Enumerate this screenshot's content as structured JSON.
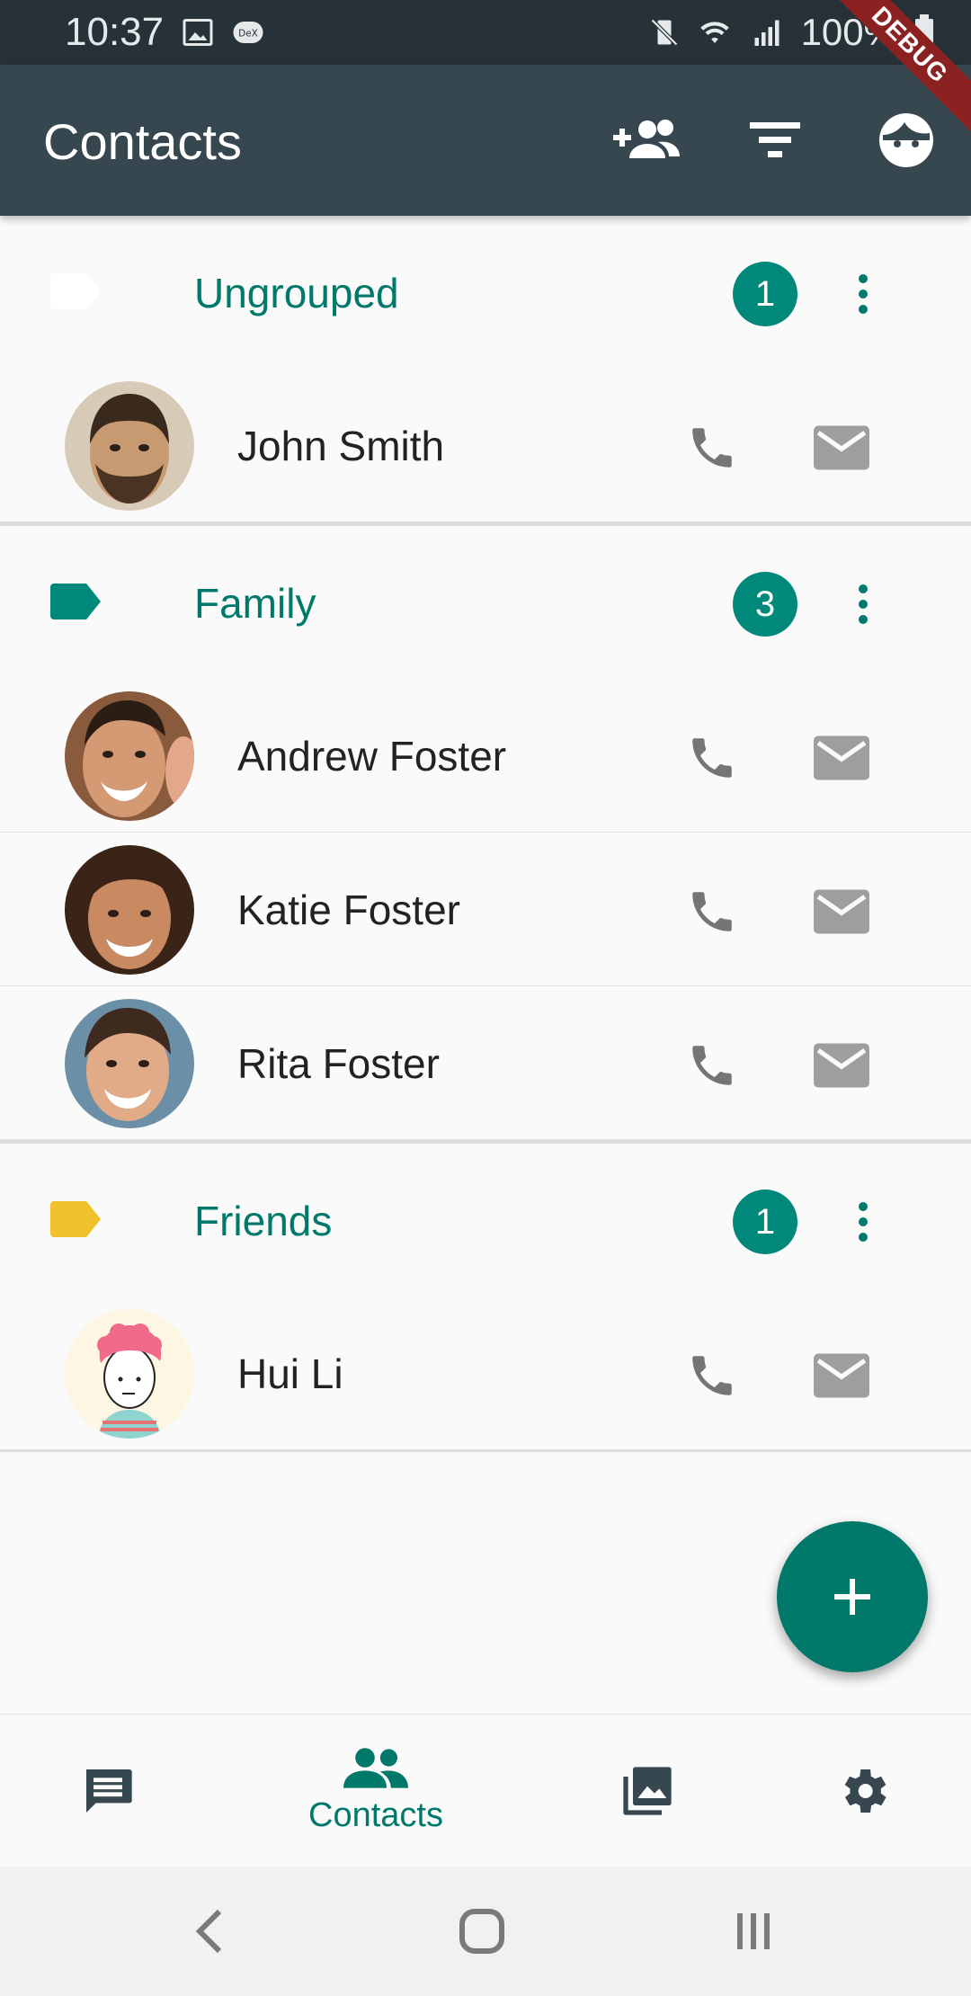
{
  "status_bar": {
    "time": "10:37",
    "battery": "100%",
    "debug_label": "DEBUG"
  },
  "app_bar": {
    "title": "Contacts",
    "actions": [
      "add-contact-icon",
      "filter-icon",
      "profile-face-icon"
    ]
  },
  "groups": [
    {
      "name": "Ungrouped",
      "count": "1",
      "tag_color": "#ffffff",
      "contacts": [
        {
          "name": "John Smith",
          "avatar": "man-beard-photo"
        }
      ]
    },
    {
      "name": "Family",
      "count": "3",
      "tag_color": "#00897b",
      "contacts": [
        {
          "name": "Andrew Foster",
          "avatar": "smiling-man-photo"
        },
        {
          "name": "Katie Foster",
          "avatar": "smiling-woman-photo"
        },
        {
          "name": "Rita Foster",
          "avatar": "smiling-girl-photo"
        }
      ]
    },
    {
      "name": "Friends",
      "count": "1",
      "tag_color": "#f0c12c",
      "contacts": [
        {
          "name": "Hui Li",
          "avatar": "cartoon-pink-hair"
        }
      ]
    }
  ],
  "fab": {
    "icon": "plus-icon"
  },
  "bottom_nav": {
    "items": [
      {
        "icon": "chat-icon",
        "label": ""
      },
      {
        "icon": "people-icon",
        "label": "Contacts",
        "active": true
      },
      {
        "icon": "photo-library-icon",
        "label": ""
      },
      {
        "icon": "settings-gear-icon",
        "label": ""
      }
    ]
  },
  "colors": {
    "primary": "#00796b",
    "app_bar": "#37474f",
    "status_bar": "#263238",
    "icon_grey": "#757575"
  }
}
